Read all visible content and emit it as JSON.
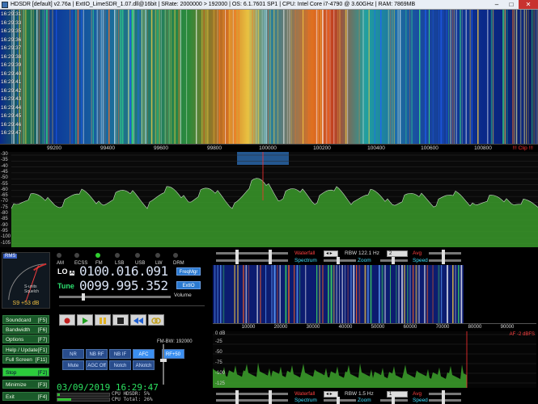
{
  "window": {
    "title": "HDSDR  [default]  v2.76a  |  ExtIO_LimeSDR_1.07.dll@16bit  |  SRate: 2000000 > 192000  |  OS: 6.1.7601 SP1  |  CPU: Intel Core i7-4790 @ 3.60GHz  |  RAM: 7869MB",
    "minimize": "–",
    "maximize": "□",
    "close": "✕"
  },
  "waterfall": {
    "timestamps": [
      "16:29:31",
      "16:29:33",
      "16:29:35",
      "16:29:36",
      "16:29:37",
      "16:29:38",
      "16:29:39",
      "16:29:40",
      "16:29:41",
      "16:29:42",
      "16:29:43",
      "16:29:44",
      "16:29:45",
      "16:29:46",
      "16:29:47"
    ]
  },
  "freq_axis": {
    "ticks": [
      "99200",
      "99400",
      "99600",
      "99800",
      "100000",
      "100200",
      "100400",
      "100600",
      "100800"
    ],
    "clip": "!!! Clip !!!"
  },
  "spectrum": {
    "db_labels": [
      "-30",
      "-35",
      "-40",
      "-45",
      "-50",
      "-55",
      "-60",
      "-65",
      "-70",
      "-75",
      "-80",
      "-85",
      "-90",
      "-95",
      "-100",
      "-105"
    ]
  },
  "smeter": {
    "badge": "RMS",
    "reading": "S9 +53 dB",
    "units": "S-units",
    "squelch": "Squelch",
    "scale": [
      "+40",
      "+20",
      "9",
      "7",
      "5",
      "3",
      "1"
    ]
  },
  "left_buttons": [
    {
      "label": "Soundcard",
      "key": "[F5]"
    },
    {
      "label": "Bandwidth",
      "key": "[F6]"
    },
    {
      "label": "Options",
      "key": "[F7]"
    },
    {
      "label": "Help / Update",
      "key": "[F1]"
    },
    {
      "label": "Full Screen",
      "key": "[F11]"
    },
    {
      "label": "Stop",
      "key": "[F2]"
    },
    {
      "label": "Minimize",
      "key": "[F3]"
    },
    {
      "label": "Exit",
      "key": "[F4]"
    }
  ],
  "modes": [
    {
      "label": "AM",
      "on": false
    },
    {
      "label": "ECSS",
      "on": false
    },
    {
      "label": "FM",
      "on": true
    },
    {
      "label": "LSB",
      "on": false
    },
    {
      "label": "USB",
      "on": false
    },
    {
      "label": "LW",
      "on": false
    },
    {
      "label": "DRM",
      "on": false
    }
  ],
  "lo": {
    "label": "LO",
    "lock": "A",
    "value": "0100.016.091",
    "button": "FreqMgr"
  },
  "tune": {
    "label": "Tune",
    "value": "0099.995.352",
    "button": "ExtIO"
  },
  "volume_label": "Volume",
  "fm_bw": "FM-BW: 192000",
  "dsp_buttons": [
    {
      "label": "NR",
      "on": false
    },
    {
      "label": "NB RF",
      "on": false
    },
    {
      "label": "NB IF",
      "on": false
    },
    {
      "label": "AFC",
      "on": true
    },
    {
      "label": "Mute",
      "on": false
    },
    {
      "label": "AGC Off",
      "on": false
    },
    {
      "label": "Notch",
      "on": false
    },
    {
      "label": "ANotch",
      "on": false
    }
  ],
  "rf_button": "RF+50",
  "datetime": "03/09/2019 16:29:47",
  "cpu": {
    "hdsdr": "CPU HDSDR:  5%",
    "total": "CPU Total: 26%"
  },
  "rf_header": {
    "waterfall": "Waterfall",
    "spectrum": "Spectrum",
    "rbw": "RBW 122.1 Hz",
    "rbw_sel": "2",
    "avg": "Avg",
    "zoom": "Zoom",
    "speed": "Speed"
  },
  "af_header": {
    "waterfall": "Waterfall",
    "spectrum": "Spectrum",
    "rbw": "RBW   1.5 Hz",
    "rbw_sel": "1",
    "avg": "Avg",
    "zoom": "Zoom",
    "speed": "Speed"
  },
  "af_axis": [
    "10000",
    "20000",
    "30000",
    "40000",
    "50000",
    "60000",
    "70000",
    "80000",
    "90000"
  ],
  "af_spec": {
    "top": "0 dB",
    "label": "AF -2 dBFS",
    "ylabels": [
      "-25",
      "-50",
      "-75",
      "-100",
      "-125"
    ]
  },
  "colors": {
    "accent": "#3b8ff0",
    "green": "#2ccd3c",
    "red": "#ff4040",
    "cyan": "#40e0ff"
  }
}
